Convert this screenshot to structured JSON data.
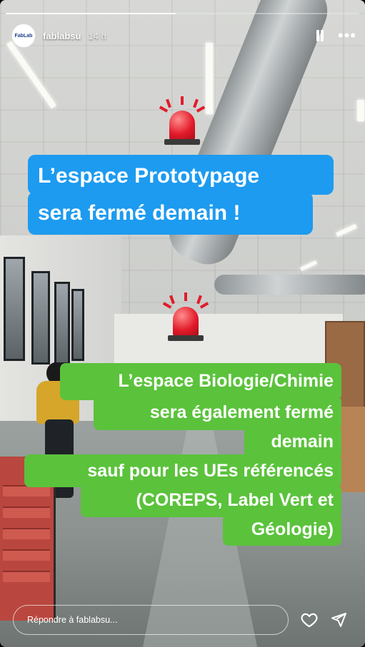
{
  "progress": {
    "fraction": 0.48
  },
  "header": {
    "avatar_text": "FabLab",
    "username": "fablabsu",
    "time": "14 h",
    "pause_icon": "pause-icon",
    "more_icon": "more-icon"
  },
  "story": {
    "blue_text": {
      "line1": "L’espace Prototypage",
      "line2": "sera fermé demain !"
    },
    "green_text": {
      "line1": "L’espace Biologie/Chimie",
      "line2": "sera également fermé",
      "line3": "demain",
      "line4": "sauf pour les UEs référencés",
      "line5": "(COREPS, Label Vert et",
      "line6": "Géologie)"
    },
    "siren_icon": "police-siren-icon",
    "colors": {
      "blue": "#1d9bf0",
      "green": "#5bc23c"
    }
  },
  "footer": {
    "reply_placeholder": "Répondre à fablabsu...",
    "heart_icon": "heart-icon",
    "send_icon": "send-icon"
  }
}
